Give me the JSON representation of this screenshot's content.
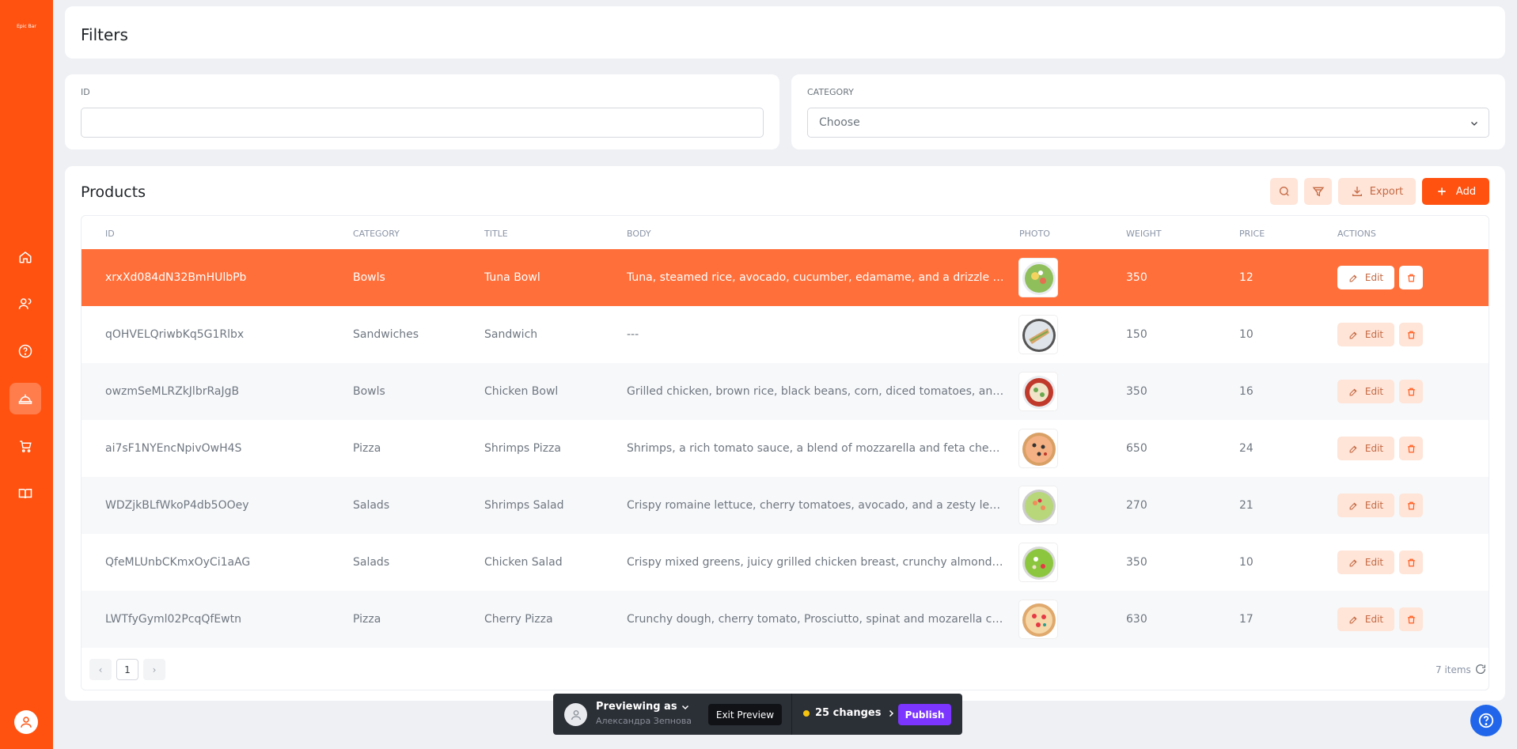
{
  "app": {
    "logo_text": "Epic Bar"
  },
  "sidebar": {
    "items": [
      {
        "icon": "home-icon",
        "active": false
      },
      {
        "icon": "users-icon",
        "active": false
      },
      {
        "icon": "help-circle-icon",
        "active": false
      },
      {
        "icon": "food-tray-icon",
        "active": true
      },
      {
        "icon": "cart-icon",
        "active": false
      },
      {
        "icon": "book-icon",
        "active": false
      }
    ]
  },
  "filters": {
    "title": "Filters",
    "id_label": "ID",
    "id_value": "",
    "category_label": "CATEGORY",
    "category_placeholder": "Choose"
  },
  "products": {
    "title": "Products",
    "export_label": "Export",
    "add_label": "Add",
    "columns": [
      "ID",
      "CATEGORY",
      "TITLE",
      "BODY",
      "PHOTO",
      "WEIGHT",
      "PRICE",
      "ACTIONS"
    ],
    "edit_label": "Edit",
    "rows": [
      {
        "id": "xrxXd084dN32BmHUlbPb",
        "category": "Bowls",
        "title": "Tuna Bowl",
        "body": "Tuna, steamed rice, avocado, cucumber, edamame, and a drizzle of spicy mayo",
        "weight": "350",
        "price": "12",
        "photo": "bowl"
      },
      {
        "id": "qOHVELQriwbKq5G1Rlbx",
        "category": "Sandwiches",
        "title": "Sandwich",
        "body": "---",
        "weight": "150",
        "price": "10",
        "photo": "sandwich"
      },
      {
        "id": "owzmSeMLRZkJlbrRaJgB",
        "category": "Bowls",
        "title": "Chicken Bowl",
        "body": "Grilled chicken, brown rice, black beans, corn, diced tomatoes, and a spritz of lime",
        "weight": "350",
        "price": "16",
        "photo": "bowl2"
      },
      {
        "id": "ai7sF1NYEncNpivOwH4S",
        "category": "Pizza",
        "title": "Shrimps Pizza",
        "body": "Shrimps, a rich tomato sauce, a blend of mozzarella and feta cheeses, sliced olives",
        "weight": "650",
        "price": "24",
        "photo": "pizza"
      },
      {
        "id": "WDZjkBLfWkoP4db5OOey",
        "category": "Salads",
        "title": "Shrimps Salad",
        "body": "Crispy romaine lettuce, cherry tomatoes, avocado, and a zesty lemon dressing",
        "weight": "270",
        "price": "21",
        "photo": "salad"
      },
      {
        "id": "QfeMLUnbCKmxOyCi1aAG",
        "category": "Salads",
        "title": "Chicken Salad",
        "body": "Crispy mixed greens, juicy grilled chicken breast, crunchy almonds, sweet cranberries",
        "weight": "350",
        "price": "10",
        "photo": "salad2"
      },
      {
        "id": "LWTfyGyml02PcqQfEwtn",
        "category": "Pizza",
        "title": "Cherry Pizza",
        "body": "Crunchy dough, cherry tomato, Prosciutto, spinat and mozarella cheese",
        "weight": "630",
        "price": "17",
        "photo": "pizza2"
      }
    ],
    "pagination": {
      "prev": "‹",
      "current": "1",
      "next": "›",
      "items_count": "7 items"
    }
  },
  "preview_bar": {
    "label": "Previewing as",
    "user": "Александра Зепнова",
    "exit_label": "Exit Preview",
    "changes_label": "25 changes",
    "publish_label": "Publish"
  },
  "colors": {
    "accent": "#ff5210",
    "selected_row": "#ff6f3a",
    "publish": "#7b35ff",
    "help": "#2166ea"
  }
}
